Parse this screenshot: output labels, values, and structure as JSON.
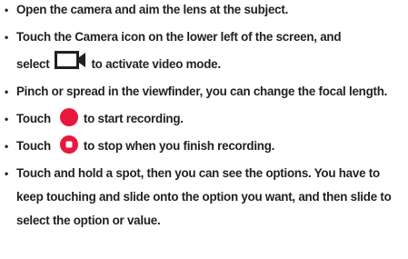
{
  "bullet_glyph": "•",
  "colors": {
    "text": "#231f20",
    "record": "#e8183c"
  },
  "icons": {
    "video_mode": "video-camera-icon",
    "record": "record-button-icon",
    "stop": "stop-button-icon"
  },
  "items": [
    {
      "text": "Open the camera and aim the lens at the subject."
    },
    {
      "line1": "Touch the Camera icon on the lower left of the screen, and",
      "before": "select",
      "after": "to activate video mode."
    },
    {
      "text": "Pinch or spread in the viewfinder, you can change the focal length."
    },
    {
      "before": "Touch",
      "after": "to start recording."
    },
    {
      "before": "Touch",
      "after": "to stop when you finish recording."
    },
    {
      "text": "Touch and hold a spot, then you can see the options. You have to keep touching and slide onto the option you want, and then slide to select the option or value."
    }
  ]
}
